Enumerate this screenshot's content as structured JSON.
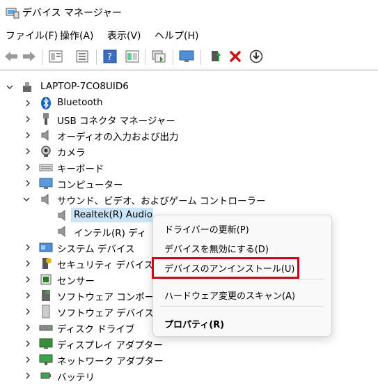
{
  "window": {
    "title": "デバイス マネージャー"
  },
  "menu": [
    "ファイル(F)",
    "操作(A)",
    "表示(V)",
    "ヘルプ(H)"
  ],
  "toolbar": {
    "icons": [
      "back-arrow-icon",
      "forward-arrow-icon",
      "properties-icon",
      "update-driver-list-icon",
      "help-icon",
      "show-hidden-icon",
      "scan-hardware-icon",
      "monitor-icon",
      "add-driver-icon",
      "uninstall-x-icon",
      "download-icon"
    ]
  },
  "tree": {
    "root": "LAPTOP-7CO8UID6",
    "categories": [
      "Bluetooth",
      "USB コネクタ マネージャー",
      "オーディオの入力および出力",
      "カメラ",
      "キーボード",
      "コンピューター",
      "サウンド、ビデオ、およびゲーム コントローラー",
      "Realtek(R) Audio",
      "インテル(R) ディ",
      "システム デバイス",
      "セキュリティ デバイス",
      "センサー",
      "ソフトウェア コンポー",
      "ソフトウェア デバイス",
      "ディスク ドライブ",
      "ディスプレイ アダプター",
      "ネットワーク アダプター",
      "バッテリ"
    ]
  },
  "context_menu": {
    "items": [
      "ドライバーの更新(P)",
      "デバイスを無効にする(D)",
      "デバイスのアンインストール(U)",
      "ハードウェア変更のスキャン(A)",
      "プロパティ(R)"
    ],
    "highlight_color": "#d0021b"
  }
}
